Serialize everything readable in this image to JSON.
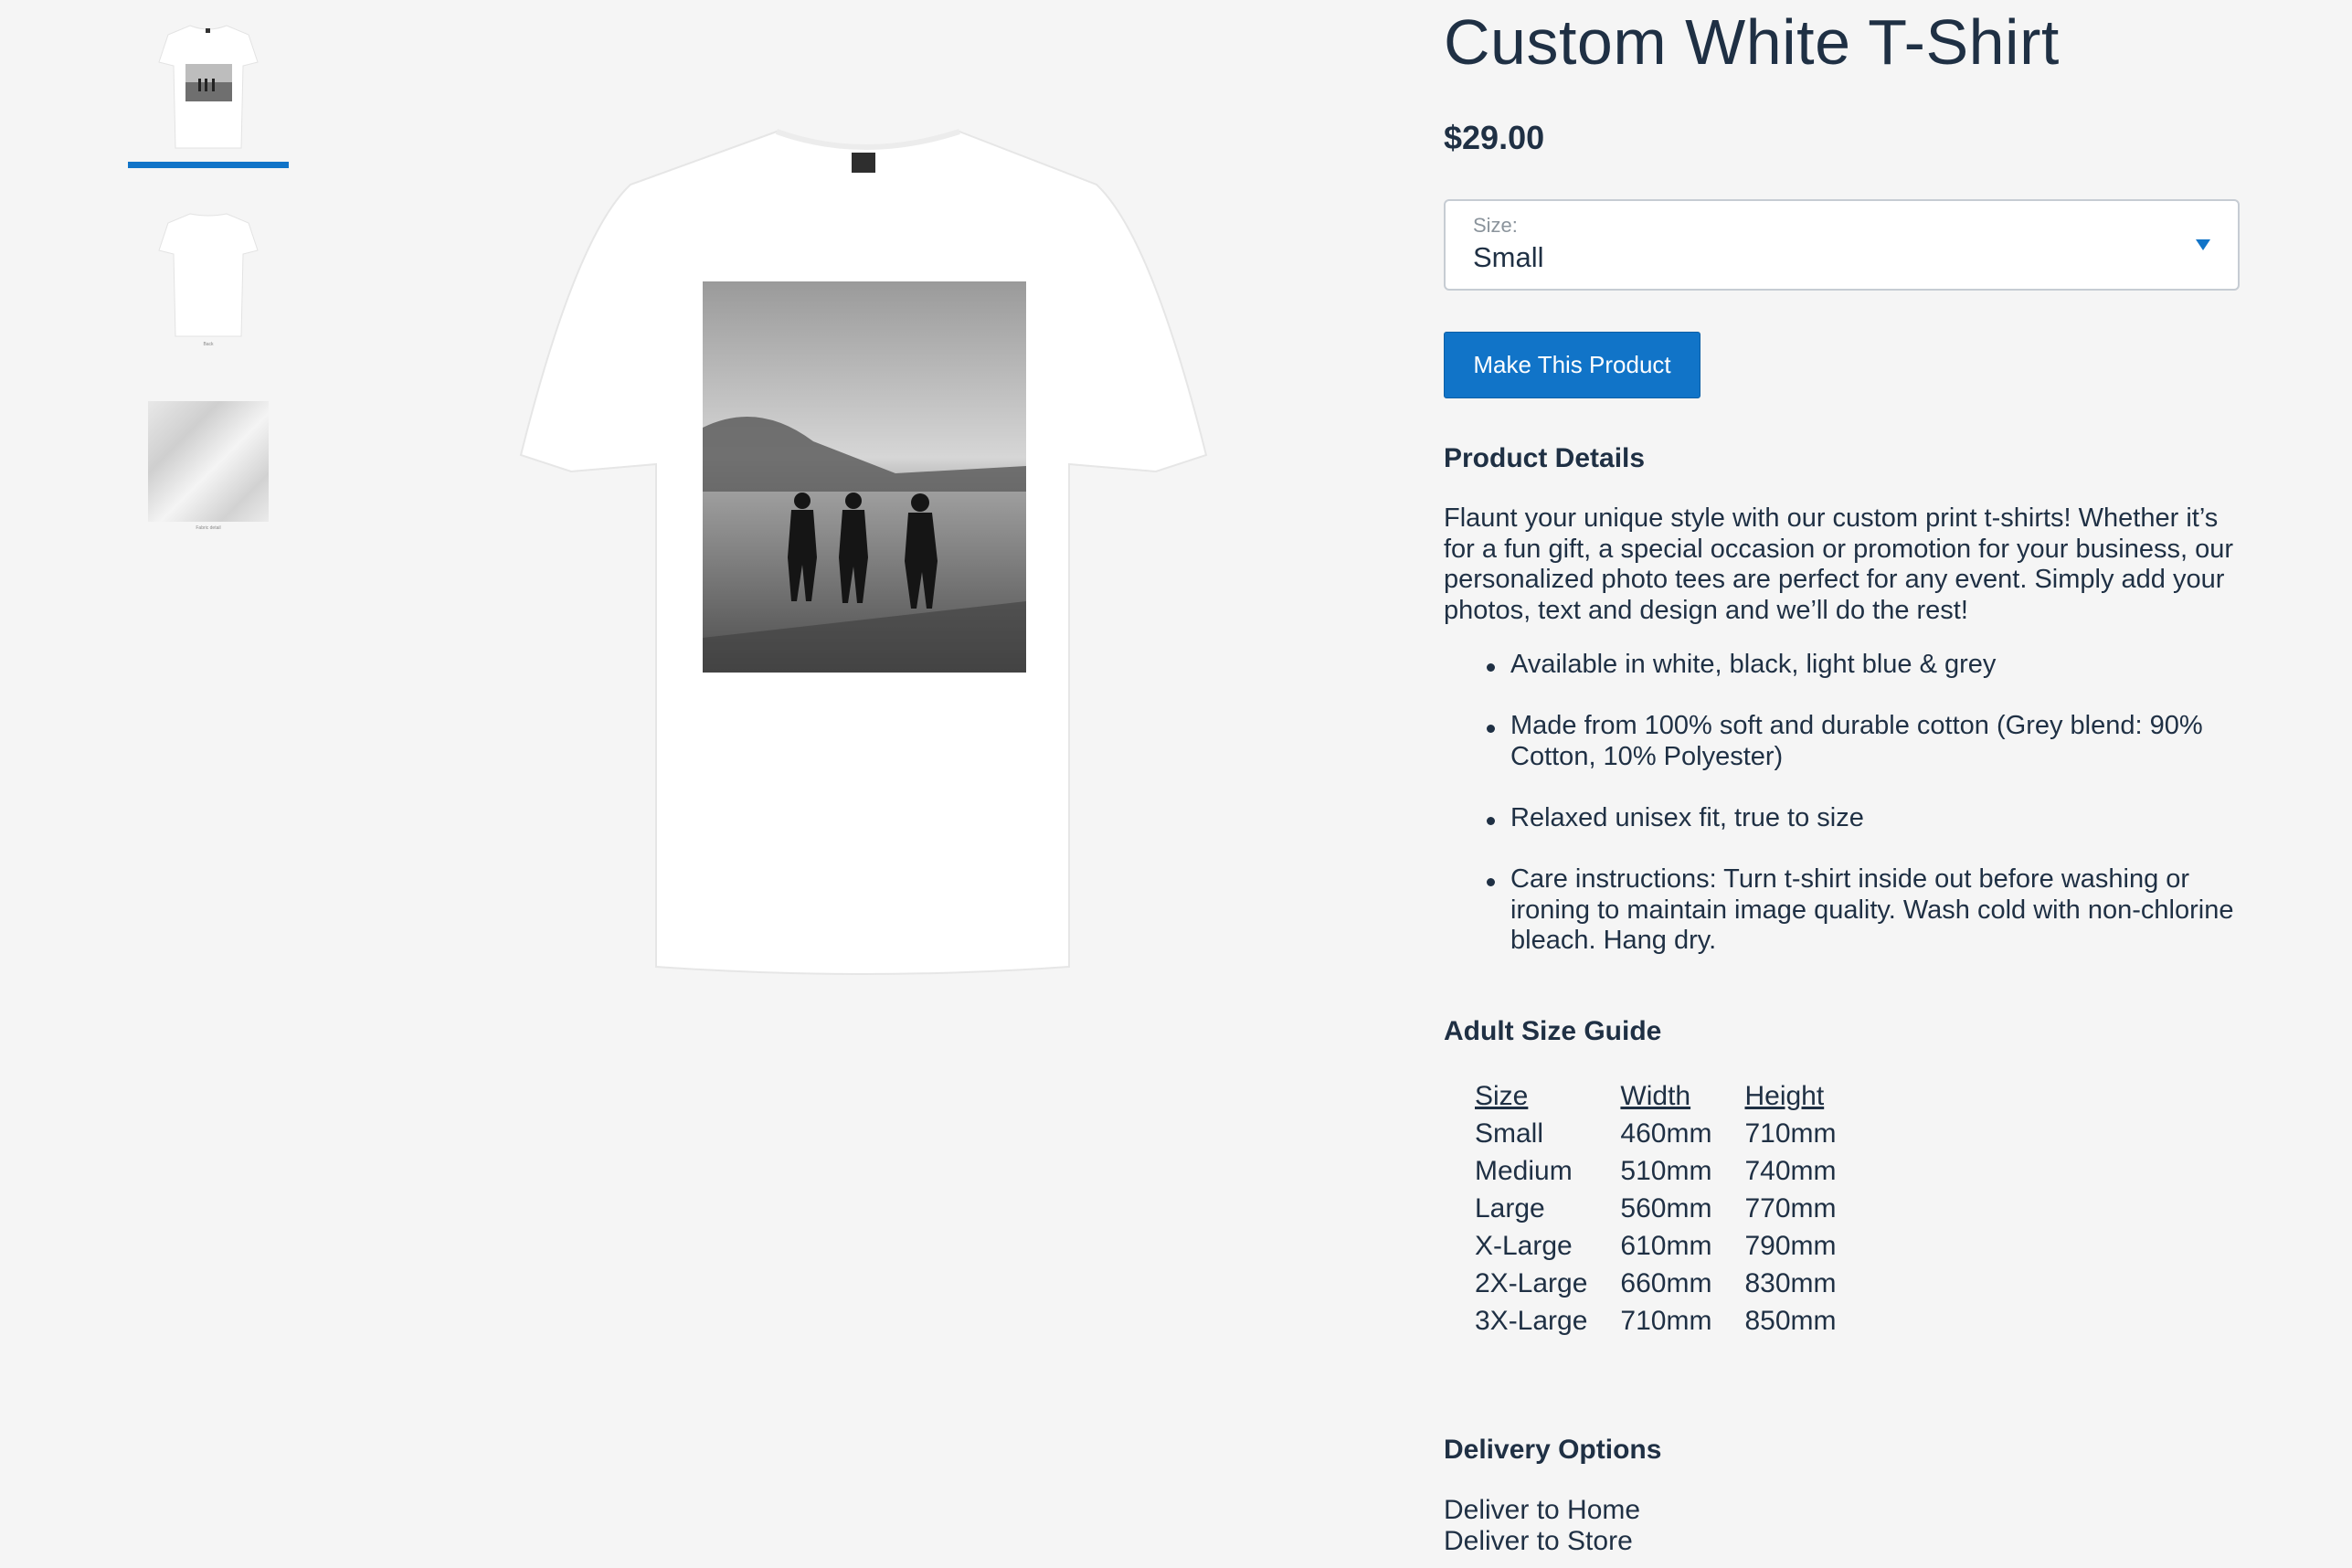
{
  "gallery": {
    "thumbnails": [
      {
        "kind": "tee-front",
        "caption": "",
        "selected": true
      },
      {
        "kind": "tee-back",
        "caption": "Back",
        "selected": false
      },
      {
        "kind": "fabric-swatch",
        "caption": "Fabric detail",
        "selected": false
      }
    ],
    "accent_color": "#1174c8"
  },
  "product": {
    "title": "Custom White T-Shirt",
    "price": "$29.00",
    "size_select": {
      "label": "Size:",
      "value": "Small"
    },
    "cta_label": "Make This Product"
  },
  "details": {
    "heading": "Product Details",
    "paragraph": "Flaunt your unique style with our custom print t-shirts! Whether it’s for a fun gift, a special occasion or promotion for your business, our personalized photo tees are perfect for any event. Simply add your photos, text and design and we’ll do the rest!",
    "bullets": [
      "Available in white, black, light blue & grey",
      "Made from 100% soft and durable cotton (Grey blend: 90% Cotton, 10% Polyester)",
      "Relaxed unisex fit, true to size",
      "Care instructions: Turn t-shirt inside out before washing or ironing to maintain image quality. Wash cold with non-chlorine bleach. Hang dry."
    ]
  },
  "size_guide": {
    "heading": "Adult Size Guide",
    "columns": [
      "Size",
      "Width",
      "Height"
    ],
    "rows": [
      [
        "Small",
        "460mm",
        "710mm"
      ],
      [
        "Medium",
        "510mm",
        "740mm"
      ],
      [
        "Large",
        "560mm",
        "770mm"
      ],
      [
        "X-Large",
        "610mm",
        "790mm"
      ],
      [
        "2X-Large",
        "660mm",
        "830mm"
      ],
      [
        "3X-Large",
        "710mm",
        "850mm"
      ]
    ]
  },
  "delivery": {
    "heading": "Delivery Options",
    "options": [
      "Deliver to Home",
      "Deliver to Store"
    ]
  }
}
